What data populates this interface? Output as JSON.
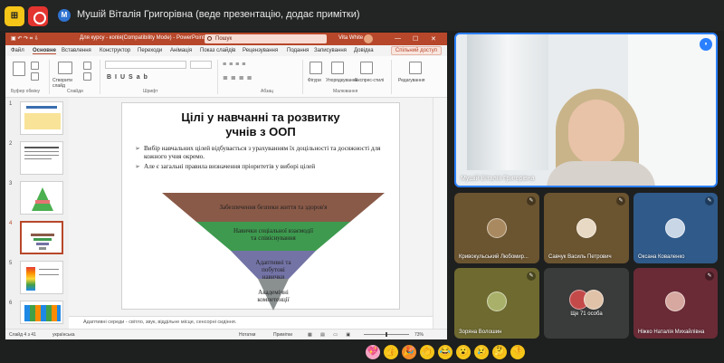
{
  "topbar": {
    "app_icon_letter": "⊞",
    "presenter_initial": "М",
    "presenter_title": "Мушій Віталія Григорівна (веде презентацію, додає примітки)"
  },
  "powerpoint": {
    "doc_title": "Для курсу - копія(Compatibility Mode) - PowerPoint",
    "search_placeholder": "Пошук",
    "user_name": "Vita White",
    "user_initials": "VW",
    "tabs": [
      "Файл",
      "Основне",
      "Вставлення",
      "Конструктор",
      "Переходи",
      "Анімація",
      "Показ слайдів",
      "Рецензування",
      "Подання",
      "Записування",
      "Довідка"
    ],
    "active_tab": "Основне",
    "share_label": "Спільний доступ",
    "ribbon": {
      "groups": [
        "Буфер обміну",
        "Слайди",
        "Шрифт",
        "Абзац",
        "Малювання",
        "Редагування"
      ],
      "new_slide_label": "Створити слайд",
      "shapes_label": "Фігури",
      "arrange_label": "Упорядкування",
      "quick_styles_label": "Експрес-стилі",
      "editing_label": "Редагування"
    },
    "slide_numbers": [
      "1",
      "2",
      "3",
      "4",
      "5",
      "6"
    ],
    "selected_slide": "4",
    "slide": {
      "title_line1": "Цілі у навчанні та розвитку",
      "title_line2": "учнів з ООП",
      "bullets": [
        "Вибір навчальних цілей відбувається з урахуванням їх доцільності та досяжності для  кожного учня окремо.",
        "Але є загальні правила визначення пріоритетів у виборі цілей"
      ],
      "pyramid_levels": [
        {
          "label": "Забезпечення безпеки життя та здоров'я",
          "color": "#8a5a48"
        },
        {
          "label": "Навички соціальної взаємодії та співіснування",
          "color": "#3e9a4f"
        },
        {
          "label": "Адаптивні та побутові навички",
          "color": "#7373a6"
        },
        {
          "label": "Академічні компетенції",
          "color": "#8a8f8f"
        }
      ]
    },
    "notes": "Адаптивні середи - світло, звук, віддільне місце, сенсорні сидіння.",
    "status": {
      "slide_counter": "Слайд 4 з 41",
      "language": "українська",
      "notes_btn": "Нотатки",
      "comments_btn": "Примітки",
      "zoom": "73%"
    }
  },
  "participants": {
    "presenter_video": {
      "name": "Мушій Віталія Григорівна"
    },
    "tiles": [
      {
        "name": "Кривокульський Любомир...",
        "bg": "#6b5430"
      },
      {
        "name": "Савчук Василь Петрович",
        "bg": "#6b5430"
      },
      {
        "name": "Оксана Коваленко",
        "bg": "#2f5a8a"
      },
      {
        "name": "Зоряна Волошин",
        "bg": "#6f6a30"
      },
      {
        "name": "Ще 71 особа",
        "bg": "#3a3b3b"
      },
      {
        "name": "Ніжко Наталія Михайлівна",
        "bg": "#6a2b36"
      }
    ]
  },
  "reactions": [
    "💖",
    "👍",
    "🎉",
    "👏",
    "😂",
    "😮",
    "😢",
    "🤔",
    "👎"
  ]
}
